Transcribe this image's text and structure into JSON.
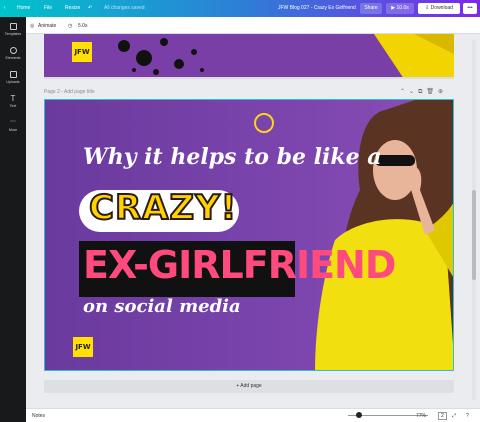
{
  "topbar": {
    "home": "Home",
    "file": "File",
    "resize": "Resize",
    "saved_status": "All changes saved",
    "doc_title": "JFW Blog 027 - Crazy Ex Girlfriend",
    "share": "Share",
    "play_time": "10.0s",
    "download": "Download",
    "more": "•••"
  },
  "sidebar": {
    "items": [
      {
        "label": "Templates"
      },
      {
        "label": "Elements"
      },
      {
        "label": "Uploads"
      },
      {
        "label": "Text"
      },
      {
        "label": "More"
      }
    ]
  },
  "toolbar": {
    "animate": "Animate",
    "duration": "5.0s"
  },
  "pages": {
    "page2_label": "Page 2 - Add page title",
    "add_page": "+ Add page"
  },
  "design": {
    "logo_text": "JFW",
    "headline": "Why it helps to be like a",
    "crazy": "CRAZY!",
    "exgf": "EX-GIRLFRIEND",
    "social": "on social media"
  },
  "bottombar": {
    "notes": "Notes",
    "zoom": "77%",
    "page_count": "2"
  },
  "colors": {
    "accent_purple": "#7d2ae8",
    "accent_teal": "#00c4cc",
    "design_bg": "#7b45ad",
    "crazy_yellow": "#ffd200",
    "exgf_pink": "#ff4a7d"
  }
}
